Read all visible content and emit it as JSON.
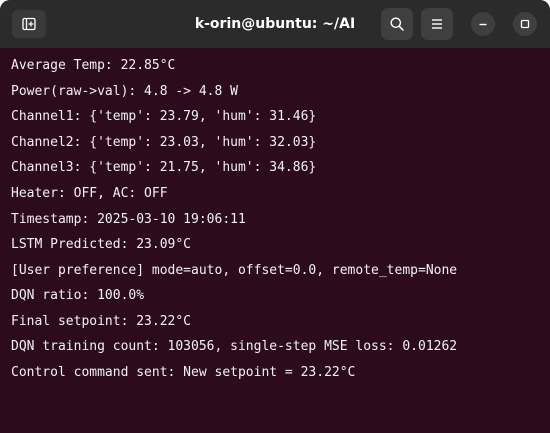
{
  "window": {
    "title": "k-orin@ubuntu: ~/AI",
    "background": "#2c0b1f",
    "titlebar_color": "#2b2b2b",
    "text_color": "#f2f2f2"
  },
  "titlebar": {
    "new_tab_icon": "new-tab-icon",
    "search_icon": "search-icon",
    "menu_icon": "hamburger-menu-icon",
    "minimize_icon": "minimize-icon",
    "maximize_icon": "maximize-icon"
  },
  "terminal": {
    "lines": [
      "Average Temp: 22.85°C",
      "Power(raw->val): 4.8 -> 4.8 W",
      "Channel1: {'temp': 23.79, 'hum': 31.46}",
      "Channel2: {'temp': 23.03, 'hum': 32.03}",
      "Channel3: {'temp': 21.75, 'hum': 34.86}",
      "Heater: OFF, AC: OFF",
      "Timestamp: 2025-03-10 19:06:11",
      "LSTM Predicted: 23.09°C",
      "[User preference] mode=auto, offset=0.0, remote_temp=None",
      "DQN ratio: 100.0%",
      "Final setpoint: 23.22°C",
      "DQN training count: 103056, single-step MSE loss: 0.01262",
      "Control command sent: New setpoint = 23.22°C"
    ]
  }
}
